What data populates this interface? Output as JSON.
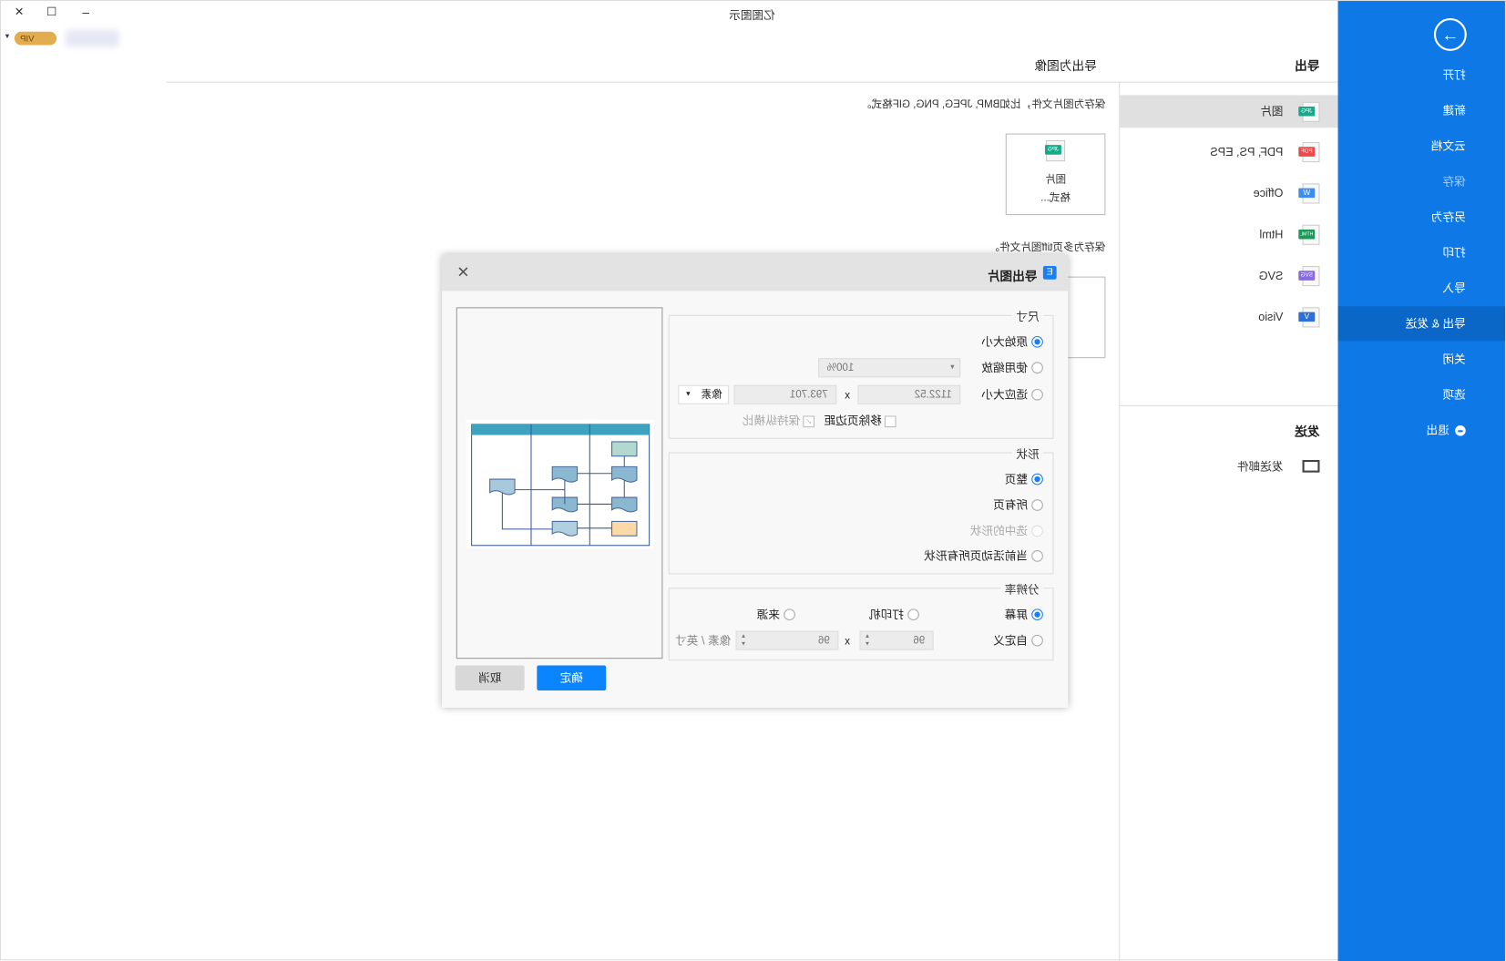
{
  "window": {
    "title": "亿图图示",
    "vip": "VIP",
    "controls": {
      "minimize": "–",
      "maximize": "☐",
      "close": "✕"
    }
  },
  "sidebar": {
    "items": [
      {
        "label": "打开"
      },
      {
        "label": "新建"
      },
      {
        "label": "云文档"
      },
      {
        "label": "保存",
        "disabled": true
      },
      {
        "label": "另存为"
      },
      {
        "label": "打印"
      },
      {
        "label": "导入"
      },
      {
        "label": "导出 & 发送",
        "selected": true
      },
      {
        "label": "关闭"
      },
      {
        "label": "选项"
      },
      {
        "label": "退出"
      }
    ]
  },
  "export_panel": {
    "heading": "导出",
    "items": [
      {
        "label": "图片",
        "tag": "JPG",
        "color": "#1aa88a",
        "selected": true
      },
      {
        "label": "PDF, PS, EPS",
        "tag": "PDF",
        "color": "#e84b4b"
      },
      {
        "label": "Office",
        "tag": "W",
        "color": "#3d8cf0"
      },
      {
        "label": "Html",
        "tag": "HTML",
        "color": "#1a9a5a"
      },
      {
        "label": "SVG",
        "tag": "SVG",
        "color": "#8a6ae0"
      },
      {
        "label": "Visio",
        "tag": "V",
        "color": "#2f6fd8"
      }
    ],
    "send_heading": "发送",
    "send_items": [
      {
        "label": "发送邮件"
      }
    ]
  },
  "content": {
    "heading": "导出为图像",
    "desc1": "保存为图片文件，比如BMP, JPEG, PNG, GIF格式。",
    "card1": {
      "tag": "JPG",
      "line1": "图片",
      "line2": "格式..."
    },
    "desc2": "保存为多页tiff图片文件。"
  },
  "dialog": {
    "title": "导出图片",
    "size": {
      "legend": "尺寸",
      "original": "原始大小",
      "scale": "使用缩放",
      "scale_value": "100%",
      "fit": "适应大小",
      "width": "1122.52",
      "x": "x",
      "height": "793.701",
      "unit": "像素",
      "remove_margin": "移除页边距",
      "keep_ratio": "保持纵横比"
    },
    "shape": {
      "legend": "形状",
      "whole_page": "整页",
      "all_pages": "所有页",
      "selected": "选中的形状",
      "current_page_all": "当前活动页所有形状"
    },
    "resolution": {
      "legend": "分辨率",
      "screen": "屏幕",
      "printer": "打印机",
      "source": "来源",
      "custom": "自定义",
      "dpi_x": "96",
      "x": "x",
      "dpi_y": "96",
      "unit": "像素 / 英寸"
    },
    "ok": "确定",
    "cancel": "取消"
  },
  "colors": {
    "accent": "#0d78e6",
    "sidebar_selected": "#0a67c7",
    "button": "#0a84ff"
  }
}
